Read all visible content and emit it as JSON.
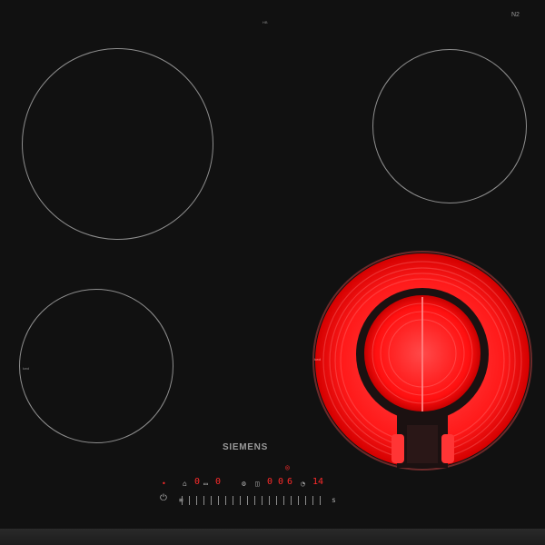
{
  "appliance": {
    "brand": "SIEMENS",
    "top_right_mark": "N2",
    "top_center_label": "HB",
    "zone_labels": {
      "front_left": "kwd",
      "front_right": "kwd"
    }
  },
  "controls": {
    "left_icon": "power-icon",
    "display_1": "0",
    "display_2": "0",
    "display_3": "0",
    "display_4": "0",
    "active_level": "6",
    "timer_value": "14",
    "end_symbol": "s"
  },
  "colors": {
    "glass": "#111111",
    "zone_outline": "#8e8e8e",
    "heating_red": "#ff1a1a",
    "display_red": "#ff2b2b"
  },
  "heating_level_fraction": 0.6
}
